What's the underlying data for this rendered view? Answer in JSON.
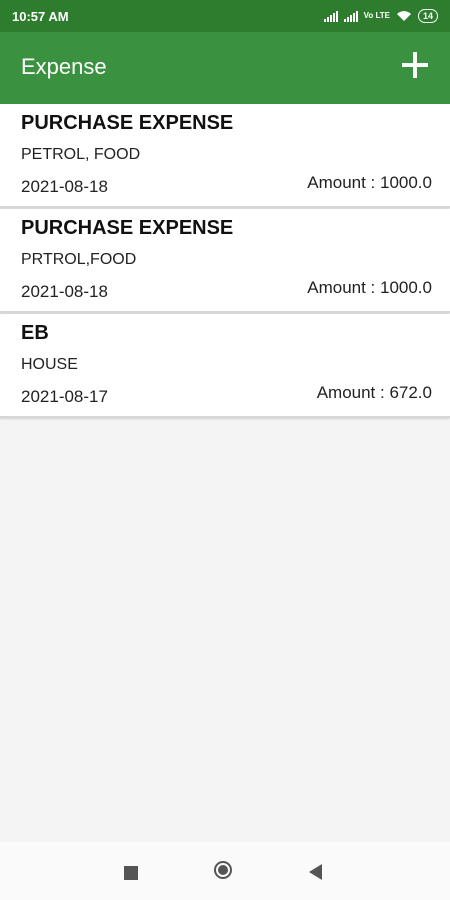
{
  "status_bar": {
    "time": "10:57 AM",
    "network_label": "Vo LTE",
    "battery": "14",
    "icons": [
      "signal-icon",
      "signal-icon",
      "volte-icon",
      "wifi-icon",
      "battery-icon"
    ]
  },
  "app_bar": {
    "title": "Expense",
    "add_icon": "plus-icon"
  },
  "expenses": [
    {
      "title": "PURCHASE EXPENSE",
      "description": "PETROL, FOOD",
      "date": "2021-08-18",
      "amount": "Amount : 1000.0"
    },
    {
      "title": "PURCHASE EXPENSE",
      "description": "PRTROL,FOOD",
      "date": "2021-08-18",
      "amount": "Amount : 1000.0"
    },
    {
      "title": "EB",
      "description": "HOUSE",
      "date": "2021-08-17",
      "amount": "Amount : 672.0"
    }
  ],
  "nav_bar": {
    "icons": [
      "recents-icon",
      "home-icon",
      "back-icon"
    ]
  },
  "colors": {
    "app_bar": "#3a9240",
    "status_bar": "#2e7d2e",
    "background": "#f4f4f4"
  }
}
